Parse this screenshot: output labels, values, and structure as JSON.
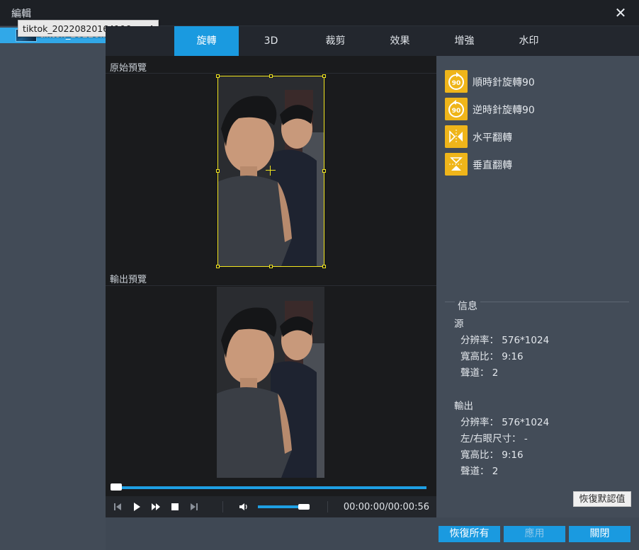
{
  "window": {
    "title": "編輯",
    "close_icon": "close-icon"
  },
  "file": {
    "name": "tiktok_20220...",
    "tooltip": "tiktok_20220820164106.mp4"
  },
  "tabs": [
    {
      "label": "旋轉",
      "active": true
    },
    {
      "label": "3D",
      "active": false
    },
    {
      "label": "裁剪",
      "active": false
    },
    {
      "label": "效果",
      "active": false
    },
    {
      "label": "增強",
      "active": false
    },
    {
      "label": "水印",
      "active": false
    }
  ],
  "preview": {
    "original_label": "原始預覽",
    "output_label": "輸出預覽"
  },
  "player": {
    "time": "00:00:00/00:00:56",
    "progress_fraction": 0.0,
    "volume_fraction": 0.85
  },
  "rotate_options": [
    {
      "label": "順時針旋轉90",
      "icon": "rotate-clockwise-icon"
    },
    {
      "label": "逆時針旋轉90",
      "icon": "rotate-counterclockwise-icon"
    },
    {
      "label": "水平翻轉",
      "icon": "flip-horizontal-icon"
    },
    {
      "label": "垂直翻轉",
      "icon": "flip-vertical-icon"
    }
  ],
  "info": {
    "title": "信息",
    "source": {
      "heading": "源",
      "resolution": "分辨率： 576*1024",
      "aspect": "寬高比： 9:16",
      "channels": "聲道： 2"
    },
    "output": {
      "heading": "輸出",
      "resolution": "分辨率： 576*1024",
      "eye_size": "左/右眼尺寸： -",
      "aspect": "寬高比： 9:16",
      "channels": "聲道： 2"
    }
  },
  "buttons": {
    "reset_default": "恢復默認值",
    "reset_all": "恢復所有",
    "apply": "應用",
    "close": "關閉"
  },
  "colors": {
    "accent": "#1a9ae0",
    "icon_bg": "#efb51a",
    "crop": "#f2e51e"
  }
}
